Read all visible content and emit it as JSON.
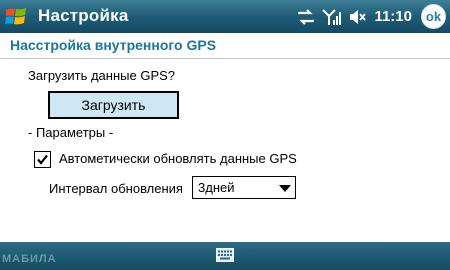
{
  "titlebar": {
    "title": "Настройка",
    "clock": "11:10",
    "ok_label": "ok",
    "start_icon": "windows-flag-icon",
    "status_icons": [
      "network-sync-icon",
      "signal-strength-icon",
      "speaker-muted-icon"
    ]
  },
  "section": {
    "title": "Насстройка внутренного GPS"
  },
  "load": {
    "question": "Загрузить данные GPS?",
    "button_label": "Загрузить"
  },
  "params": {
    "header": "- Параметры -",
    "auto_update_label": "Автометически обновлять данные GPS",
    "auto_update_checked": true,
    "interval_label": "Интервал обновления",
    "interval_value": "3дней"
  },
  "bottombar": {
    "keyboard_icon": "keyboard-icon",
    "watermark": "МАБИЛА"
  },
  "colors": {
    "title_bar": "#1f5b76",
    "section_title": "#1c76a0",
    "button_fill": "#cde8f2"
  }
}
